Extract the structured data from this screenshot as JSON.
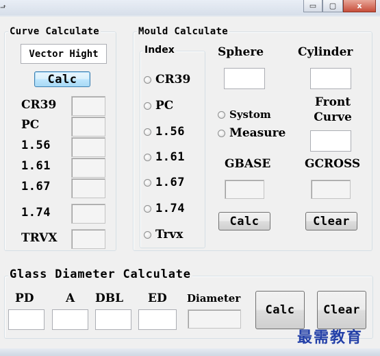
{
  "window": {
    "controls": {
      "minimize": "▭",
      "maximize": "▢",
      "close": "x"
    }
  },
  "curve_calculate": {
    "title": "Curve Calculate",
    "mode_display": "Vector Hight",
    "calc_label": "Calc",
    "rows": [
      {
        "label": "CR39",
        "value": ""
      },
      {
        "label": "PC",
        "value": ""
      },
      {
        "label": "1.56",
        "value": ""
      },
      {
        "label": "1.61",
        "value": ""
      },
      {
        "label": "1.67",
        "value": ""
      },
      {
        "label": "1.74",
        "value": ""
      },
      {
        "label": "TRVX",
        "value": ""
      }
    ]
  },
  "mould_calculate": {
    "title": "Mould Calculate",
    "index_title": "Index",
    "index_options": [
      "CR39",
      "PC",
      "1.56",
      "1.61",
      "1.67",
      "1.74",
      "Trvx"
    ],
    "sphere_label": "Sphere",
    "sphere_value": "",
    "cylinder_label": "Cylinder",
    "cylinder_value": "",
    "mode_options": [
      "Systom",
      "Measure"
    ],
    "front_curve_label": "Front Curve",
    "front_curve_value": "",
    "gbase_label": "GBASE",
    "gbase_value": "",
    "gcross_label": "GCROSS",
    "gcross_value": "",
    "calc_label": "Calc",
    "clear_label": "Clear"
  },
  "glass_diameter": {
    "title": "Glass Diameter Calculate",
    "pd_label": "PD",
    "pd_value": "",
    "a_label": "A",
    "a_value": "",
    "dbl_label": "DBL",
    "dbl_value": "",
    "ed_label": "ED",
    "ed_value": "",
    "diameter_label": "Diameter",
    "diameter_value": "",
    "calc_label": "Calc",
    "clear_label": "Clear"
  },
  "watermark": "最需教育"
}
